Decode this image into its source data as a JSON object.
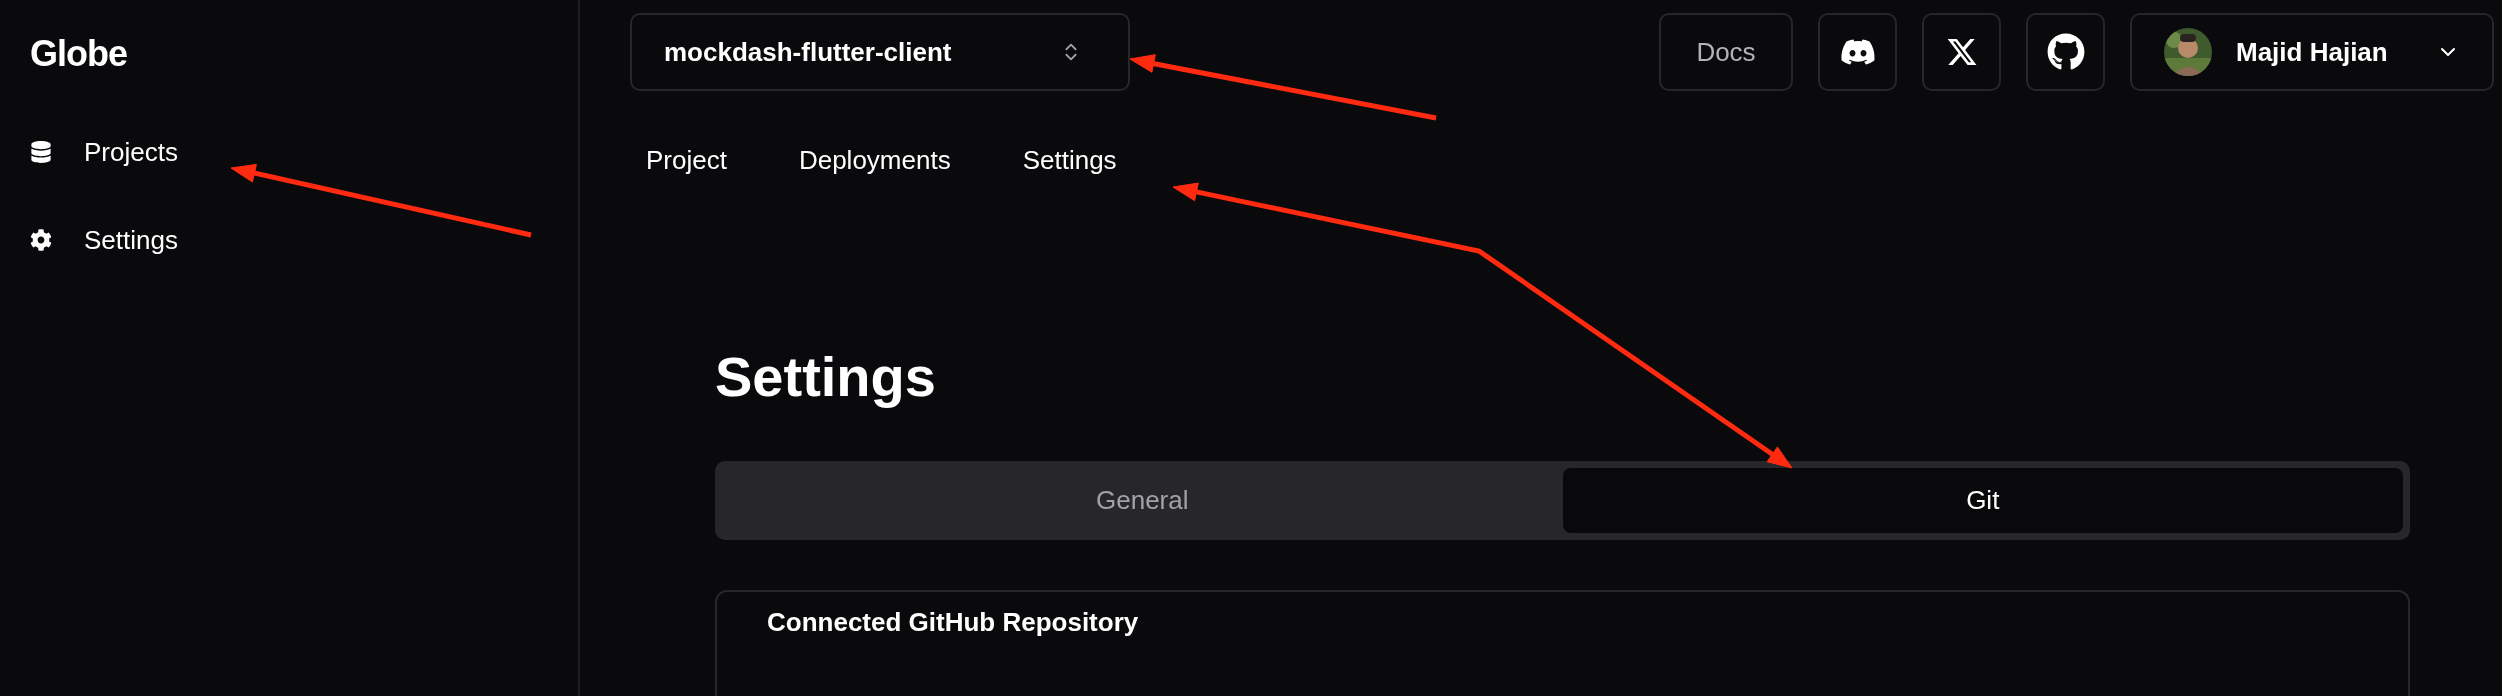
{
  "sidebar": {
    "logo": "Globe",
    "items": [
      {
        "kind": "projects",
        "label": "Projects"
      },
      {
        "kind": "settings",
        "label": "Settings"
      }
    ]
  },
  "header": {
    "project_selector": {
      "value": "mockdash-flutter-client"
    },
    "docs": "Docs",
    "social": [
      {
        "kind": "discord"
      },
      {
        "kind": "x"
      },
      {
        "kind": "github"
      }
    ],
    "user": {
      "name": "Majid Hajian"
    }
  },
  "nav": [
    "Project",
    "Deployments",
    "Settings"
  ],
  "page": {
    "title": "Settings",
    "tabs": [
      {
        "label": "General",
        "selected": false
      },
      {
        "label": "Git",
        "selected": true
      }
    ],
    "card": {
      "title": "Connected GitHub Repository"
    }
  }
}
